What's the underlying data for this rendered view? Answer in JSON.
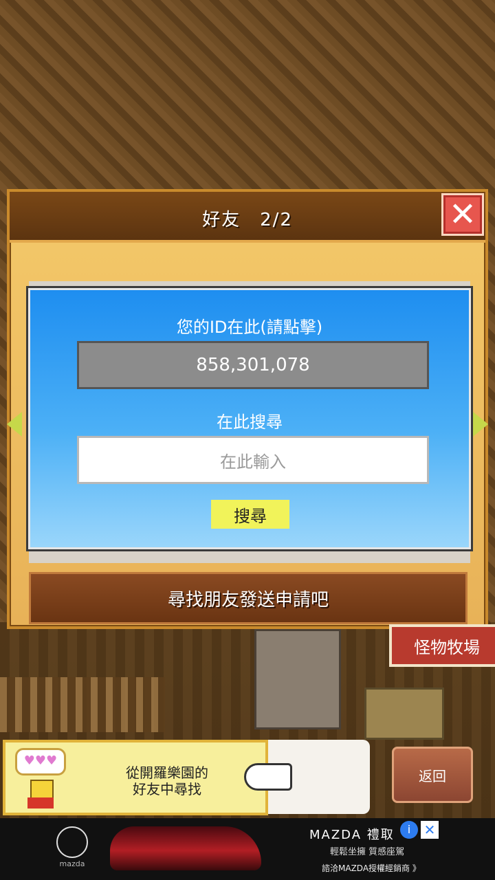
{
  "dialog": {
    "title": "好友　2/2",
    "close_label": "✕",
    "id_label": "您的ID在此(請點擊)",
    "id_value": "858,301,078",
    "search_label": "在此搜尋",
    "search_placeholder": "在此輸入",
    "search_button": "搜尋",
    "find_button": "尋找朋友發送申請吧"
  },
  "map": {
    "monster_sign": "怪物牧場"
  },
  "tip": {
    "bubble": "♥♥♥",
    "text_line1": "從開羅樂園的",
    "text_line2": "好友中尋找"
  },
  "back_button": "返回",
  "ad": {
    "brand_small": "mazda",
    "title": "MAZDA 禮取",
    "subtitle": "輕鬆坐擁 質感座駕",
    "cta": "諮洽MAZDA授權經銷商 》",
    "info_icon": "i",
    "close_icon": "✕"
  }
}
